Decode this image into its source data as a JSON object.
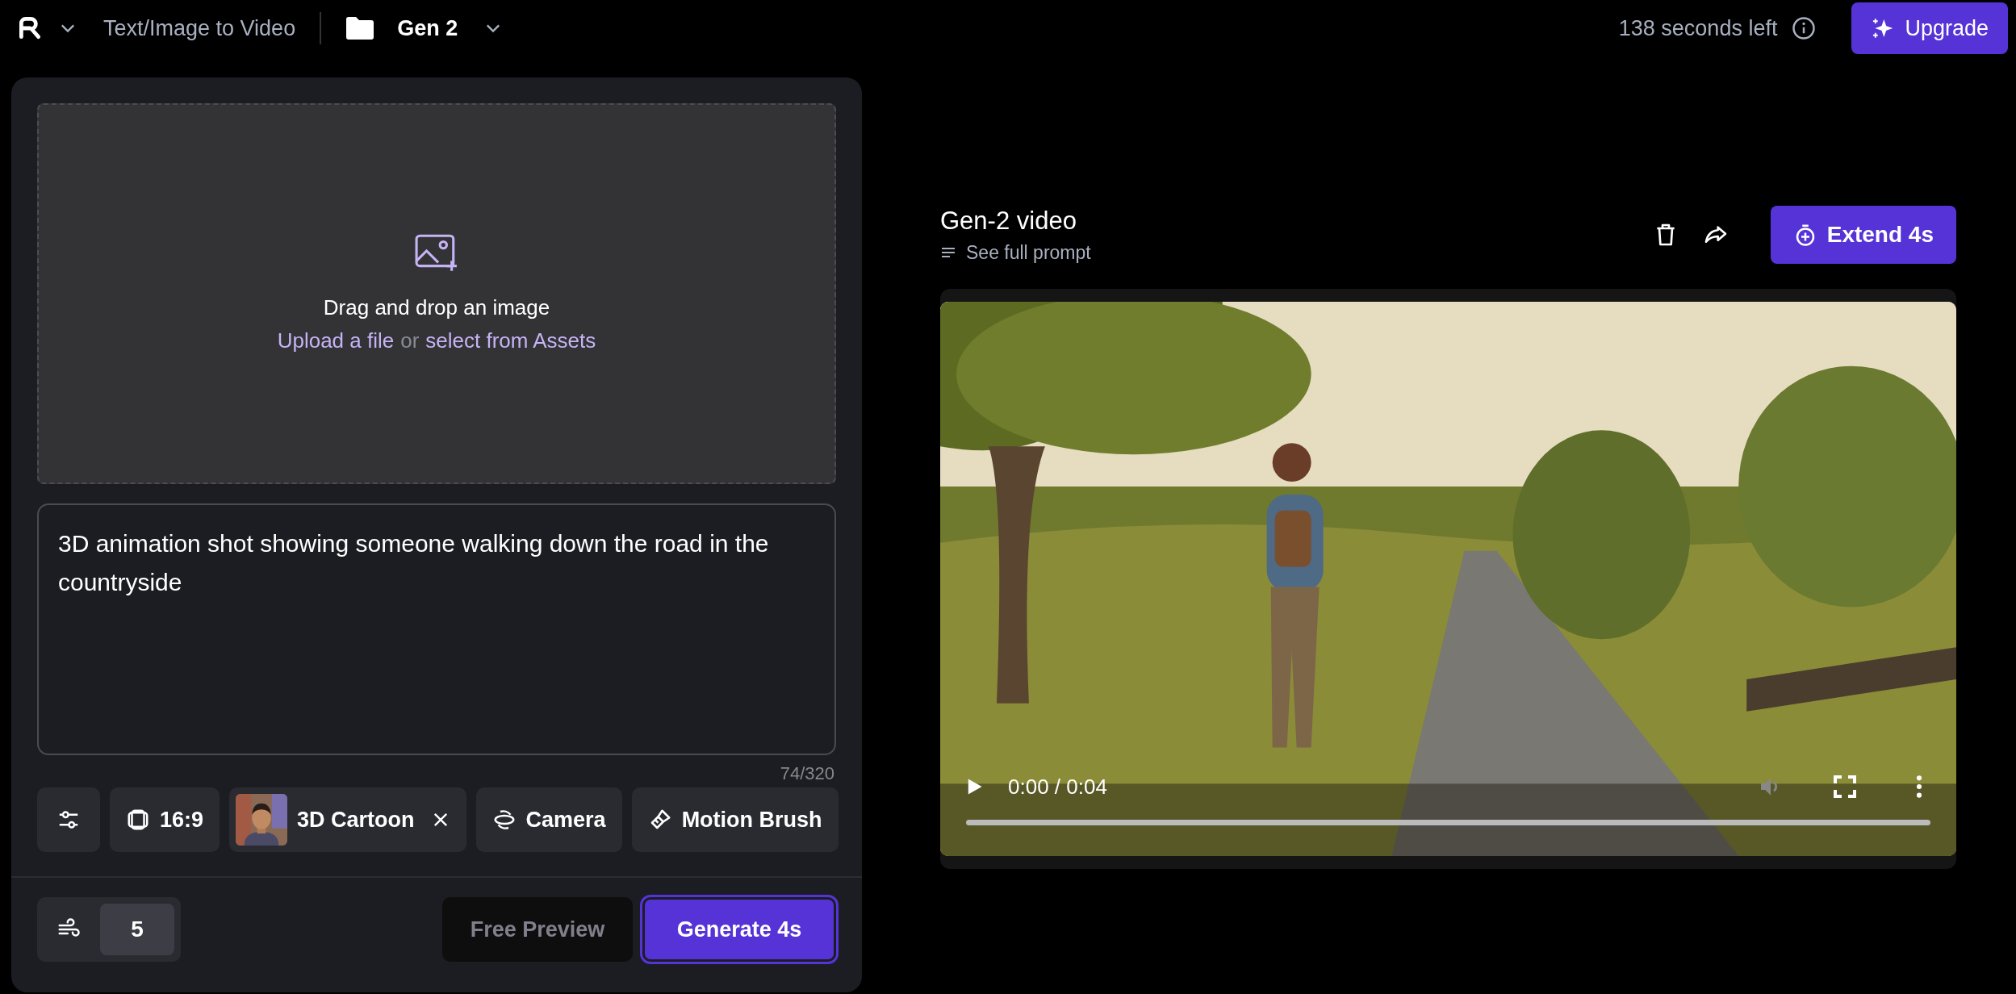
{
  "header": {
    "workspace_label": "Text/Image to Video",
    "folder": "Gen 2",
    "credits": "138 seconds left",
    "upgrade_button": "Upgrade"
  },
  "upload": {
    "title": "Drag and drop an image",
    "upload_link": "Upload a file",
    "separator": "or",
    "assets_link": "select from Assets"
  },
  "prompt": {
    "value": "3D animation shot showing someone walking down the road in the countryside",
    "counter": "74/320"
  },
  "tools": [
    {
      "kind": "settings"
    },
    {
      "kind": "aspect",
      "label": "16:9"
    },
    {
      "kind": "style",
      "label": "3D Cartoon"
    },
    {
      "kind": "camera",
      "label": "Camera"
    },
    {
      "kind": "brush",
      "label": "Motion Brush"
    }
  ],
  "motion": {
    "value": "5"
  },
  "buttons": {
    "preview": {
      "label": "Free Preview",
      "disabled": true
    },
    "generate": "Generate 4s"
  },
  "result": {
    "title": "Gen-2 video",
    "prompt_link": "See full prompt",
    "extend_button": "Extend 4s",
    "player": {
      "time": "0:00 / 0:04"
    }
  }
}
